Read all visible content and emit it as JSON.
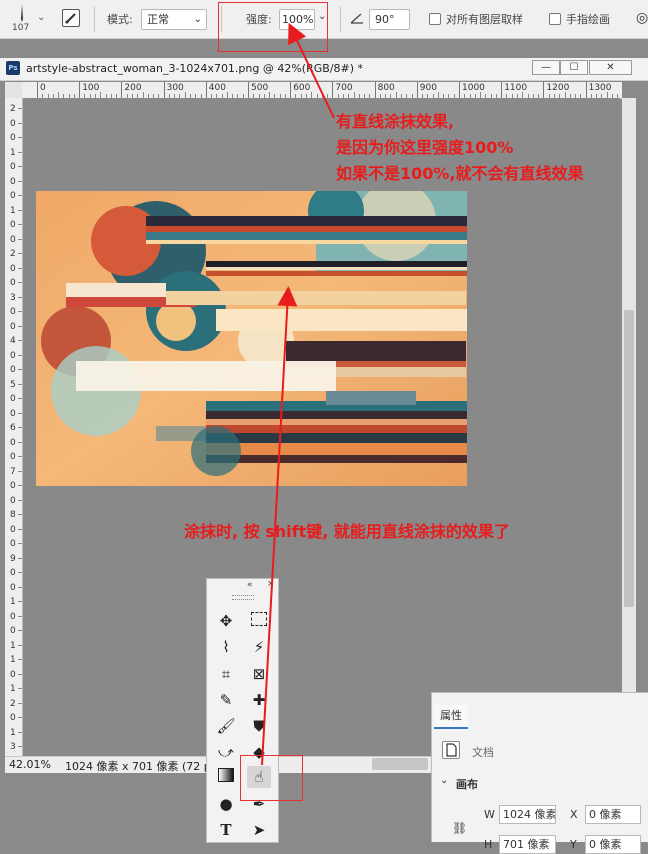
{
  "options_bar": {
    "brush_size": "107",
    "mode_label": "模式:",
    "mode_value": "正常",
    "strength_label": "强度:",
    "strength_value": "100%",
    "angle_value": "90°",
    "sample_all_layers_label": "对所有图层取样",
    "finger_painting_label": "手指绘画"
  },
  "document": {
    "title": "artstyle-abstract_woman_3-1024x701.png @ 42%(RGB/8#) *",
    "ps_badge": "Ps",
    "ruler_h_ticks": [
      "0",
      "100",
      "200",
      "300",
      "400",
      "500",
      "600",
      "700",
      "800",
      "900",
      "1000",
      "1100",
      "1200",
      "1300"
    ],
    "ruler_v_ticks": [
      "2",
      "0",
      "0",
      "1",
      "0",
      "0",
      "0",
      "1",
      "0",
      "0",
      "2",
      "0",
      "0",
      "3",
      "0",
      "0",
      "4",
      "0",
      "0",
      "5",
      "0",
      "0",
      "6",
      "0",
      "0",
      "7",
      "0",
      "0",
      "8",
      "0",
      "0",
      "9",
      "0",
      "0",
      "1",
      "0",
      "0",
      "1",
      "1",
      "0",
      "1",
      "2",
      "0",
      "1",
      "3"
    ]
  },
  "status_bar": {
    "zoom": "42.01%",
    "doc_info": "1024 像素 x 701 像素 (72 pp"
  },
  "properties": {
    "tab_label": "属性",
    "doc_label": "文档",
    "canvas_section": "画布",
    "w_label": "W",
    "w_value": "1024 像素",
    "x_label": "X",
    "x_value": "0 像素",
    "h_label": "H",
    "h_value": "701 像素",
    "y_label": "Y",
    "y_value": "0 像素"
  },
  "annotations": {
    "top_line1": "有直线涂抹效果,",
    "top_line2": "是因为你这里强度100%",
    "top_line3": "如果不是100%,就不会有直线效果",
    "bottom": "涂抹时, 按 shift键, 就能用直线涂抹的效果了"
  },
  "colors": {
    "annotation_red": "#e81c1c",
    "canvas_gray": "#898989"
  },
  "tools": [
    "move-icon",
    "marquee-icon",
    "lasso-icon",
    "magic-wand-icon",
    "crop-icon",
    "frame-icon",
    "eyedropper-icon",
    "healing-icon",
    "brush-icon",
    "stamp-icon",
    "history-brush-icon",
    "eraser-icon",
    "gradient-icon",
    "smudge-icon",
    "dodge-icon",
    "pen-icon",
    "type-icon",
    "select-arrow-icon"
  ]
}
